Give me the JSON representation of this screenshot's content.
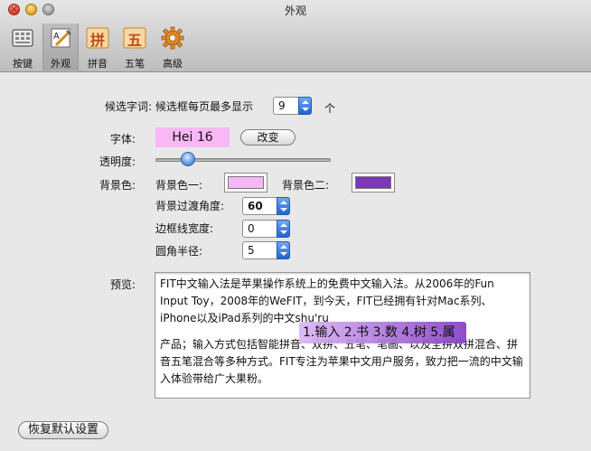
{
  "window": {
    "title": "外观",
    "controls": {
      "close_glyph": "×"
    }
  },
  "toolbar": {
    "items": [
      {
        "label": "按键",
        "icon": "keyboard-icon"
      },
      {
        "label": "外观",
        "icon": "appearance-icon",
        "selected": true
      },
      {
        "label": "拼音",
        "icon": "pinyin-icon",
        "glyph": "拼"
      },
      {
        "label": "五笔",
        "icon": "wubi-icon",
        "glyph": "五"
      },
      {
        "label": "高级",
        "icon": "gear-icon"
      }
    ]
  },
  "settings": {
    "candidates": {
      "label": "候选字词:",
      "text": "候选框每页最多显示",
      "value": "9",
      "unit": "个"
    },
    "font": {
      "label": "字体:",
      "sample": "Hei 16",
      "sample_bg": "#f8b8f4",
      "change_button": "改变"
    },
    "transparency": {
      "label": "透明度:",
      "level_fraction": 0.16
    },
    "background": {
      "label": "背景色:",
      "color1_label": "背景色一:",
      "color1": "#f7b7f6",
      "color2_label": "背景色二:",
      "color2": "#7b36b9",
      "gradient_angle_label": "背景过渡角度:",
      "gradient_angle": "60",
      "border_width_label": "边框线宽度:",
      "border_width": "0",
      "corner_radius_label": "圆角半径:",
      "corner_radius": "5"
    },
    "preview": {
      "label": "预览:",
      "paragraph1": "FIT中文输入法是苹果操作系统上的免费中文输入法。从2006年的Fun Input Toy，2008年的WeFIT，到今天，FIT已经拥有针对Mac系列、iPhone以及iPad系列的中文shu'ru",
      "paragraph2": "产品；输入方式包括智能拼音、双拼、五笔、笔画、以及全拼双拼混合、拼音五笔混合等多种方式。FIT专注为苹果中文用户服务，致力把一流的中文输入体验带给广大果粉。",
      "candidate_bar": "1.输入 2.书 3.数 4.树 5.属"
    },
    "restore_button": "恢复默认设置"
  }
}
